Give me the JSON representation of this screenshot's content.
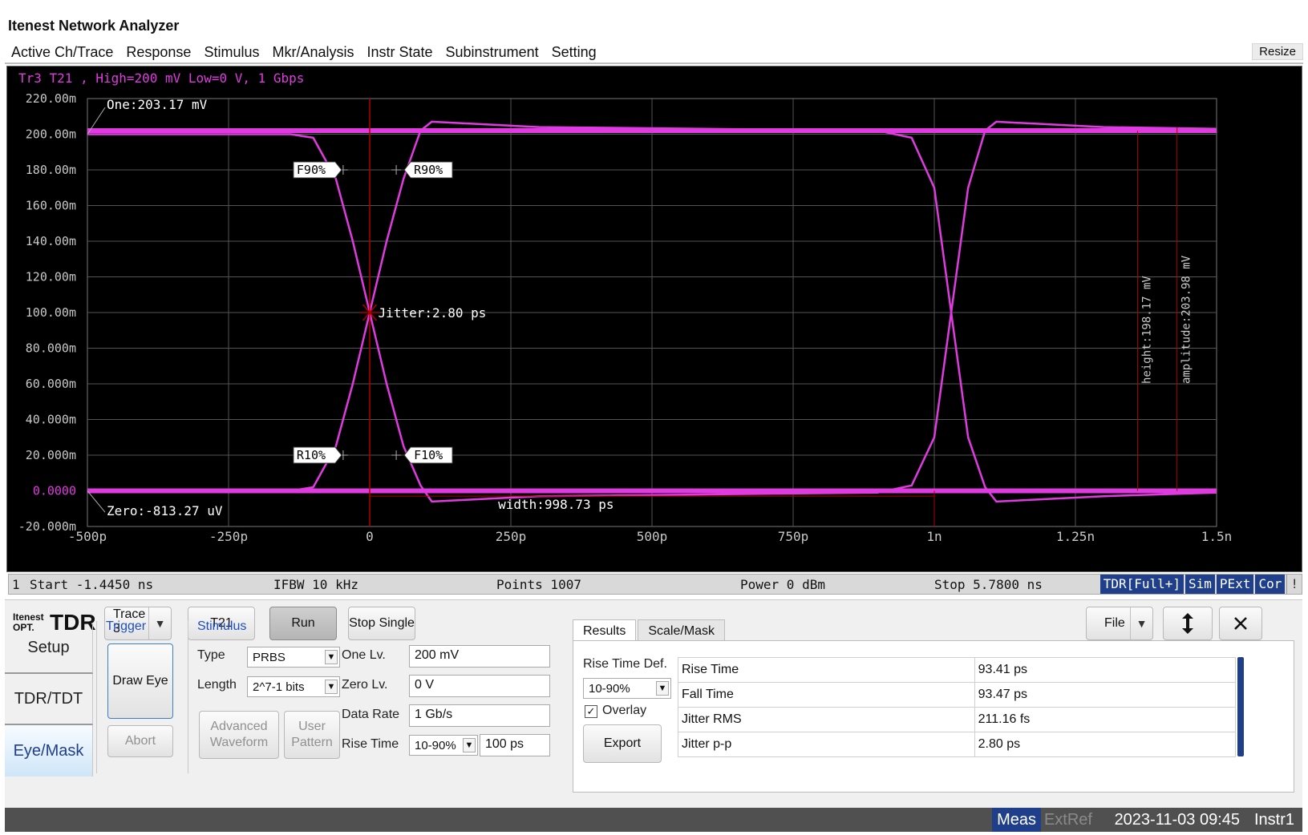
{
  "app": {
    "title": "Itenest Network Analyzer",
    "resize_label": "Resize"
  },
  "menu": [
    "Active Ch/Trace",
    "Response",
    "Stimulus",
    "Mkr/Analysis",
    "Instr State",
    "Subinstrument",
    "Setting"
  ],
  "trace_header": "Tr3 T21 , High=200 mV Low=0 V, 1 Gbps",
  "chart_data": {
    "type": "line",
    "title": "",
    "x_ticks": [
      "-500p",
      "-250p",
      "0",
      "250p",
      "500p",
      "750p",
      "1n",
      "1.25n",
      "1.5n"
    ],
    "y_ticks": [
      "220.00m",
      "200.00m",
      "180.00m",
      "160.00m",
      "140.00m",
      "120.00m",
      "100.00m",
      "80.000m",
      "60.000m",
      "40.000m",
      "20.000m",
      "0.0000",
      "-20.000m"
    ],
    "xlim_ps": [
      -500,
      1500
    ],
    "ylim_mV": [
      -20,
      220
    ],
    "series": [
      {
        "x_ps": [
          -500,
          -140,
          -100,
          -60,
          -30,
          0,
          30,
          60,
          90,
          110,
          300,
          900,
          960,
          1000,
          1030,
          1060,
          1090,
          1110,
          1300,
          1500
        ],
        "y_mV": [
          200,
          200,
          198,
          175,
          140,
          100,
          60,
          25,
          3,
          -6,
          -3,
          -1,
          3,
          30,
          100,
          170,
          202,
          207,
          204,
          203
        ]
      },
      {
        "x_ps": [
          -500,
          -140,
          -100,
          -60,
          -30,
          0,
          30,
          60,
          90,
          110,
          300,
          900,
          960,
          1000,
          1030,
          1060,
          1090,
          1110,
          1300,
          1500
        ],
        "y_mV": [
          0,
          0,
          2,
          25,
          60,
          100,
          140,
          175,
          202,
          207,
          204,
          202,
          198,
          170,
          100,
          30,
          2,
          -6,
          -3,
          -1
        ]
      }
    ],
    "annotations": {
      "one": "One:203.17 mV",
      "zero": "Zero:-813.27 uV",
      "jitter": "Jitter:2.80 ps",
      "width": "width:998.73 ps",
      "height": "height:198.17 mV",
      "amplitude": "amplitude:203.98 mV",
      "markers": [
        "F90%",
        "R90%",
        "R10%",
        "F10%"
      ]
    }
  },
  "status": {
    "channel": "1",
    "start": "Start -1.4450 ns",
    "ifbw": "IFBW 10 kHz",
    "points": "Points 1007",
    "power": "Power 0 dBm",
    "stop": "Stop 5.7800 ns",
    "badges": [
      "TDR[Full+]",
      "Sim",
      "PExt",
      "Cor",
      "!"
    ]
  },
  "toolbar": {
    "logo_small": "Itenest OPT.",
    "logo_big": "TDR",
    "trace_label": "Trace",
    "trace_value": "3",
    "t21": "T21",
    "run": "Run",
    "stop_single": "Stop Single",
    "file": "File"
  },
  "side_tabs": [
    "Setup",
    "TDR/TDT",
    "Eye/Mask"
  ],
  "trigger": {
    "label": "Trigger",
    "draw_eye": "Draw Eye",
    "abort": "Abort"
  },
  "stimulus": {
    "label": "Stimulus",
    "type_label": "Type",
    "type_value": "PRBS",
    "length_label": "Length",
    "length_value": "2^7-1 bits",
    "one_lv_label": "One Lv.",
    "one_lv_value": "200 mV",
    "zero_lv_label": "Zero Lv.",
    "zero_lv_value": "0 V",
    "data_rate_label": "Data Rate",
    "data_rate_value": "1 Gb/s",
    "rise_time_label": "Rise Time",
    "rise_time_def": "10-90%",
    "rise_time_value": "100 ps",
    "advanced_waveform": "Advanced Waveform",
    "user_pattern": "User Pattern"
  },
  "results": {
    "tabs": [
      "Results",
      "Scale/Mask"
    ],
    "rise_def_label": "Rise Time Def.",
    "rise_def_value": "10-90%",
    "overlay_label": "Overlay",
    "overlay_checked": true,
    "export": "Export",
    "rows": [
      {
        "name": "Rise Time",
        "value": "93.41 ps"
      },
      {
        "name": "Fall Time",
        "value": "93.47 ps"
      },
      {
        "name": "Jitter RMS",
        "value": "211.16 fs"
      },
      {
        "name": "Jitter p-p",
        "value": "2.80 ps"
      }
    ]
  },
  "bottom_status": {
    "meas": "Meas",
    "extref": "ExtRef",
    "datetime": "2023-11-03 09:45",
    "instr": "Instr1"
  },
  "colors": {
    "trace": "#e03be0",
    "axis_text": "#c8c8c8",
    "grid": "#555555",
    "accent": "#1f3f8a",
    "marker_line": "#b00000"
  }
}
